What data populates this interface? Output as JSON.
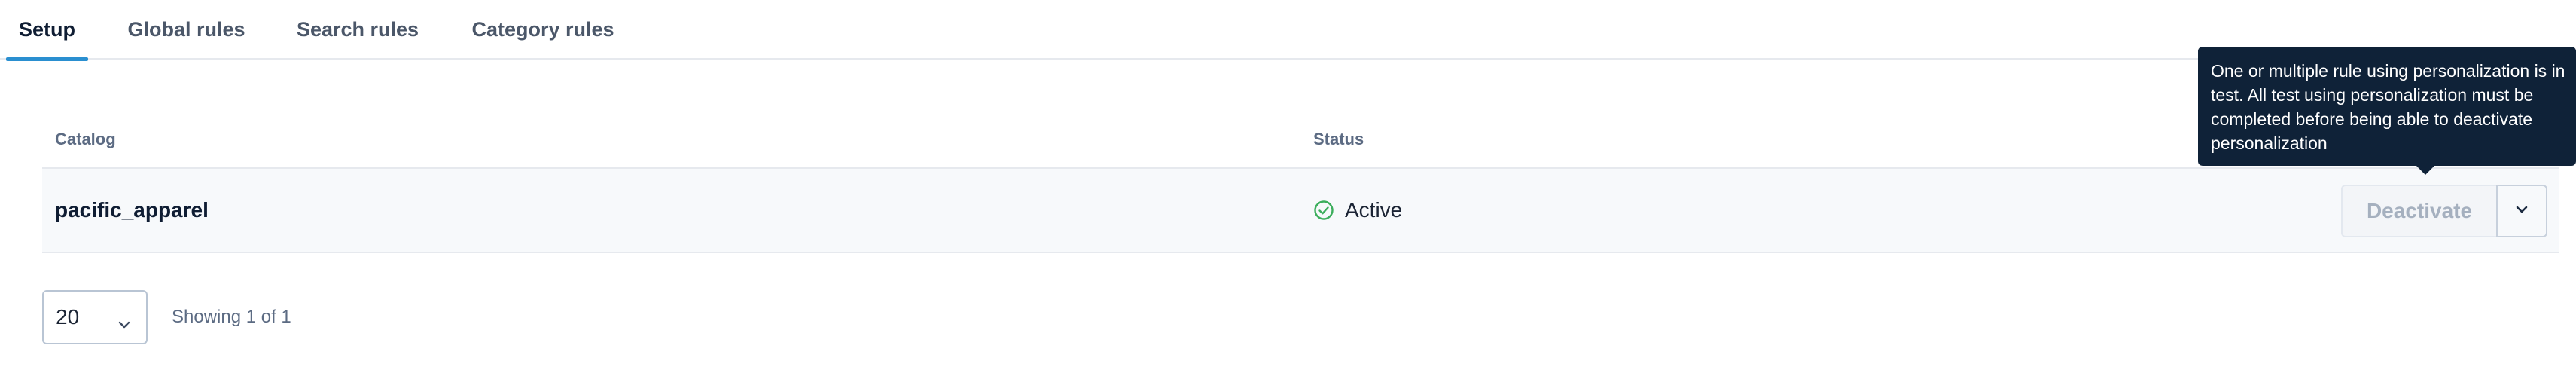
{
  "tabs": [
    {
      "label": "Setup",
      "active": true
    },
    {
      "label": "Global rules",
      "active": false
    },
    {
      "label": "Search rules",
      "active": false
    },
    {
      "label": "Category rules",
      "active": false
    }
  ],
  "table": {
    "headers": {
      "catalog": "Catalog",
      "status": "Status"
    },
    "rows": [
      {
        "catalog": "pacific_apparel",
        "status": "Active",
        "status_icon": "check-circle-icon",
        "action_label": "Deactivate"
      }
    ]
  },
  "tooltip": {
    "text": "One or multiple rule using personalization is in test. All test using personalization must be completed before being able to deactivate personalization"
  },
  "pagination": {
    "page_size": "20",
    "showing": "Showing 1 of 1"
  },
  "colors": {
    "accent": "#2a8fd0",
    "status_active": "#3cae5c",
    "tooltip_bg": "#0f2238"
  }
}
